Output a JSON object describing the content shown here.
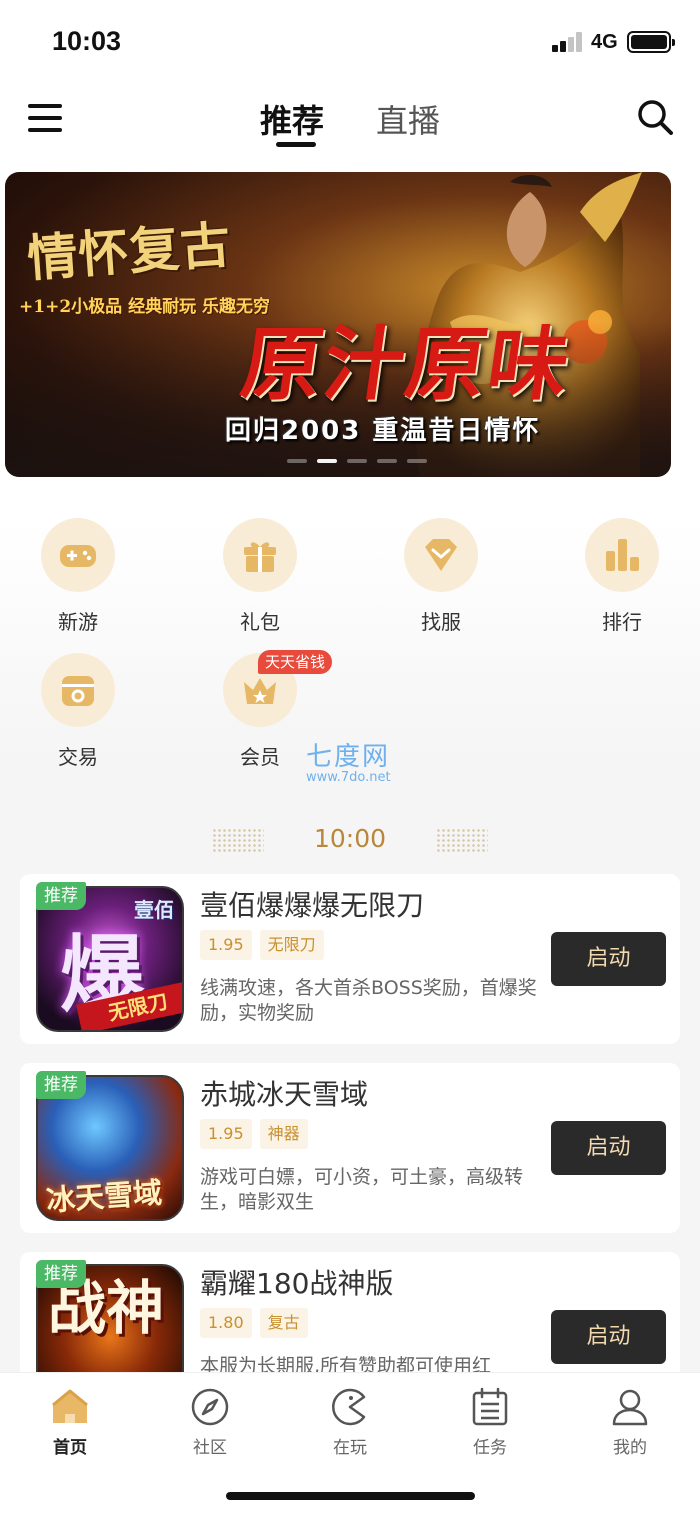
{
  "status_bar": {
    "time": "10:03",
    "network": "4G"
  },
  "header": {
    "tabs": [
      {
        "label": "推荐",
        "active": true
      },
      {
        "label": "直播",
        "active": false
      }
    ]
  },
  "banner": {
    "logo_text": "情怀复古",
    "slogan": "+1+2小极品 经典耐玩 乐趣无穷",
    "title": "原汁原味",
    "subtitle": "回归2003 重温昔日情怀",
    "slides": 5,
    "active_slide": 2
  },
  "quick_entries": [
    {
      "label": "新游",
      "icon": "gamepad-icon"
    },
    {
      "label": "礼包",
      "icon": "gift-icon"
    },
    {
      "label": "找服",
      "icon": "diamond-icon"
    },
    {
      "label": "排行",
      "icon": "ranking-icon"
    },
    {
      "label": "交易",
      "icon": "trade-icon"
    },
    {
      "label": "会员",
      "icon": "crown-icon",
      "badge": "天天省钱"
    }
  ],
  "watermark": {
    "main": "七度网",
    "sub": "www.7do.net"
  },
  "schedule": {
    "time": "10:00"
  },
  "games": [
    {
      "badge": "推荐",
      "name": "壹佰爆爆爆无限刀",
      "tags": [
        "1.95",
        "无限刀"
      ],
      "description": "线满攻速，各大首杀BOSS奖励，首爆奖励，实物奖励",
      "button": "启动",
      "art": {
        "main": "爆",
        "corner": "壹佰",
        "ribbon": "无限刀"
      }
    },
    {
      "badge": "推荐",
      "name": "赤城冰天雪域",
      "tags": [
        "1.95",
        "神器"
      ],
      "description": "游戏可白嫖，可小资，可土豪，高级转生，暗影双生",
      "button": "启动",
      "art": {
        "main": "冰天雪域"
      }
    },
    {
      "badge": "推荐",
      "name": "霸耀180战神版",
      "tags": [
        "1.80",
        "复古"
      ],
      "description": "本服为长期服,所有赞助都可使用红",
      "button": "启动",
      "art": {
        "main": "战神"
      }
    }
  ],
  "tabbar": [
    {
      "label": "首页",
      "icon": "home-icon",
      "active": true
    },
    {
      "label": "社区",
      "icon": "compass-icon",
      "active": false
    },
    {
      "label": "在玩",
      "icon": "pacman-icon",
      "active": false
    },
    {
      "label": "任务",
      "icon": "calendar-list-icon",
      "active": false
    },
    {
      "label": "我的",
      "icon": "user-icon",
      "active": false
    }
  ],
  "colors": {
    "accent": "#c8902f",
    "launch_button": "#2a2a2a",
    "recommend_badge": "#4ab865",
    "vip_badge": "#e84a3c"
  }
}
